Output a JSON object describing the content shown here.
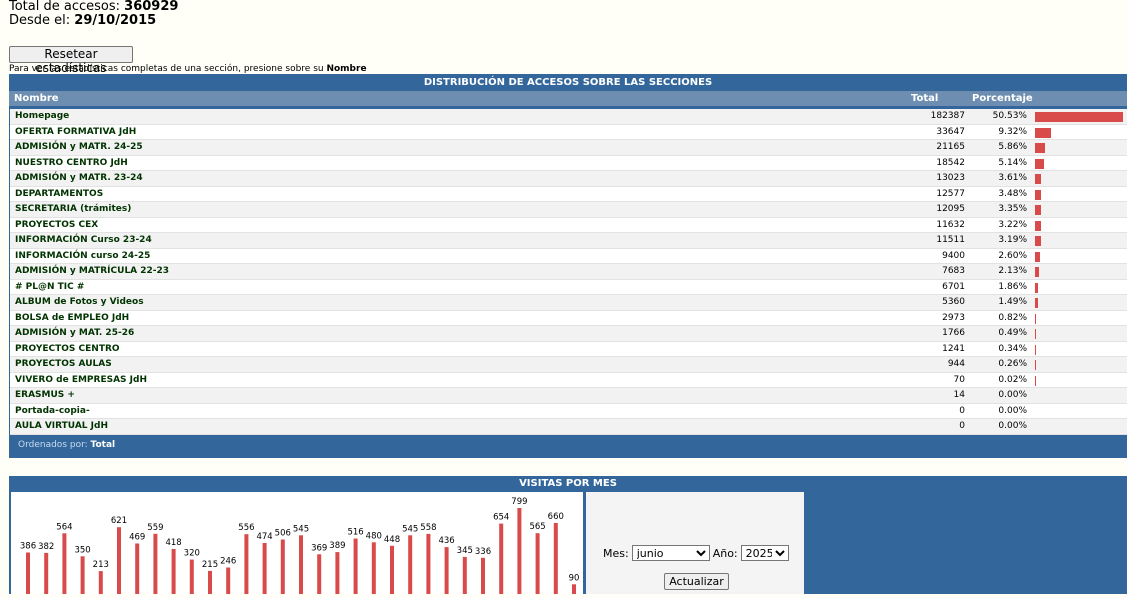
{
  "header": {
    "total_label": "Total de accesos:",
    "total_value": "360929",
    "since_label": "Desde el:",
    "since_value": "29/10/2015"
  },
  "reset_button": "Resetear estadísticas",
  "hint": {
    "text": "Para ver las estadísticas completas de una sección, presione sobre su",
    "strong": "Nombre"
  },
  "distribution": {
    "title": "DISTRIBUCIÓN DE ACCESOS SOBRE LAS SECCIONES",
    "col_name": "Nombre",
    "col_total": "Total",
    "col_percent": "Porcentaje",
    "bar_color": "#d94a4a",
    "rows": [
      {
        "name": "Homepage",
        "total": "182387",
        "percent": "50.53%",
        "share": 50.53
      },
      {
        "name": "OFERTA FORMATIVA JdH",
        "total": "33647",
        "percent": "9.32%",
        "share": 9.32
      },
      {
        "name": "ADMISIÓN y MATR. 24-25",
        "total": "21165",
        "percent": "5.86%",
        "share": 5.86
      },
      {
        "name": "NUESTRO CENTRO JdH",
        "total": "18542",
        "percent": "5.14%",
        "share": 5.14
      },
      {
        "name": "ADMISIÓN y MATR. 23-24",
        "total": "13023",
        "percent": "3.61%",
        "share": 3.61
      },
      {
        "name": "DEPARTAMENTOS",
        "total": "12577",
        "percent": "3.48%",
        "share": 3.48
      },
      {
        "name": "SECRETARIA (trámites)",
        "total": "12095",
        "percent": "3.35%",
        "share": 3.35
      },
      {
        "name": "PROYECTOS CEX",
        "total": "11632",
        "percent": "3.22%",
        "share": 3.22
      },
      {
        "name": "INFORMACIÓN Curso 23-24",
        "total": "11511",
        "percent": "3.19%",
        "share": 3.19
      },
      {
        "name": "INFORMACIÓN curso 24-25",
        "total": "9400",
        "percent": "2.60%",
        "share": 2.6
      },
      {
        "name": "ADMISIÓN y MATRÍCULA 22-23",
        "total": "7683",
        "percent": "2.13%",
        "share": 2.13
      },
      {
        "name": "# PL@N TIC #",
        "total": "6701",
        "percent": "1.86%",
        "share": 1.86
      },
      {
        "name": "ALBUM de Fotos y Videos",
        "total": "5360",
        "percent": "1.49%",
        "share": 1.49
      },
      {
        "name": "BOLSA de EMPLEO JdH",
        "total": "2973",
        "percent": "0.82%",
        "share": 0.82
      },
      {
        "name": "ADMISIÓN y MAT. 25-26",
        "total": "1766",
        "percent": "0.49%",
        "share": 0.49
      },
      {
        "name": "PROYECTOS CENTRO",
        "total": "1241",
        "percent": "0.34%",
        "share": 0.34
      },
      {
        "name": "PROYECTOS AULAS",
        "total": "944",
        "percent": "0.26%",
        "share": 0.26
      },
      {
        "name": "VIVERO de EMPRESAS JdH",
        "total": "70",
        "percent": "0.02%",
        "share": 0.02
      },
      {
        "name": "ERASMUS +",
        "total": "14",
        "percent": "0.00%",
        "share": 0
      },
      {
        "name": "Portada-copia-",
        "total": "0",
        "percent": "0.00%",
        "share": 0
      },
      {
        "name": "AULA VIRTUAL JdH",
        "total": "0",
        "percent": "0.00%",
        "share": 0
      }
    ],
    "footer_label": "Ordenados por:",
    "footer_value": "Total"
  },
  "visits": {
    "title": "VISITAS POR MES",
    "month_label": "Mes:",
    "month_value": "junio",
    "year_label": "Año:",
    "year_value": "2025",
    "update_button": "Actualizar"
  },
  "chart_data": {
    "type": "bar",
    "title": "VISITAS POR MES",
    "values": [
      386,
      382,
      564,
      350,
      213,
      621,
      469,
      559,
      418,
      320,
      215,
      246,
      556,
      474,
      506,
      545,
      369,
      389,
      516,
      480,
      448,
      545,
      558,
      436,
      345,
      336,
      654,
      799,
      565,
      660,
      90
    ],
    "bar_color": "#d94a4a"
  }
}
